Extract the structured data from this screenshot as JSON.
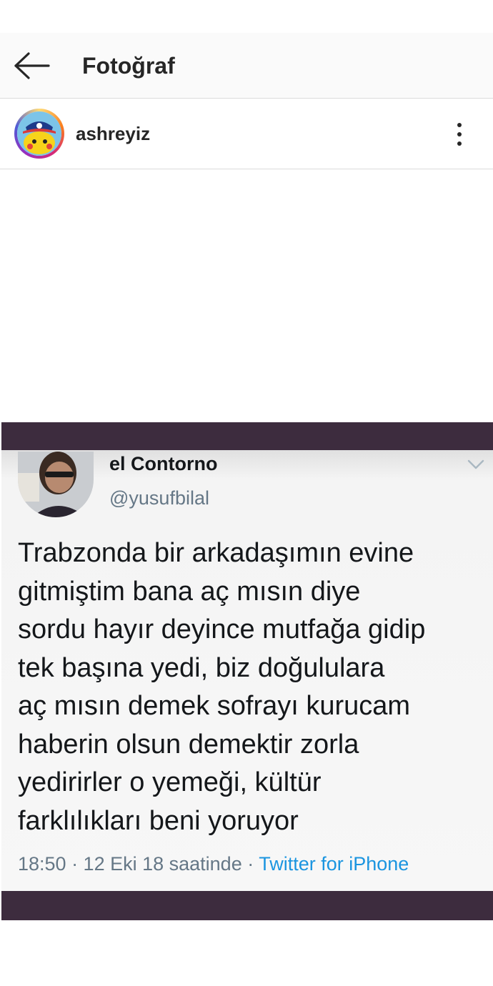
{
  "header": {
    "title": "Fotoğraf",
    "back_icon": "arrow-left-icon"
  },
  "post": {
    "username": "ashreyiz",
    "avatar": "pikachu-avatar",
    "more_icon": "more-vertical-icon"
  },
  "tweet": {
    "display_name": "el Contorno",
    "handle": "@yusufbilal",
    "text_lines": [
      "Trabzonda bir arkadaşımın evine",
      "gitmiştim bana aç mısın diye",
      "sordu hayır deyince mutfağa gidip",
      "tek başına yedi, biz doğululara",
      "aç mısın demek sofrayı kurucam",
      "haberin olsun demektir zorla",
      "yedirirler o yemeği, kültür",
      "farklılıkları beni yoruyor"
    ],
    "timestamp": "18:50 · 12 Eki 18 saatinde · ",
    "source": "Twitter for iPhone",
    "colors": {
      "text": "#14171a",
      "secondary": "#657786",
      "link": "#1b95e0",
      "band": "#3d2c3e"
    }
  }
}
